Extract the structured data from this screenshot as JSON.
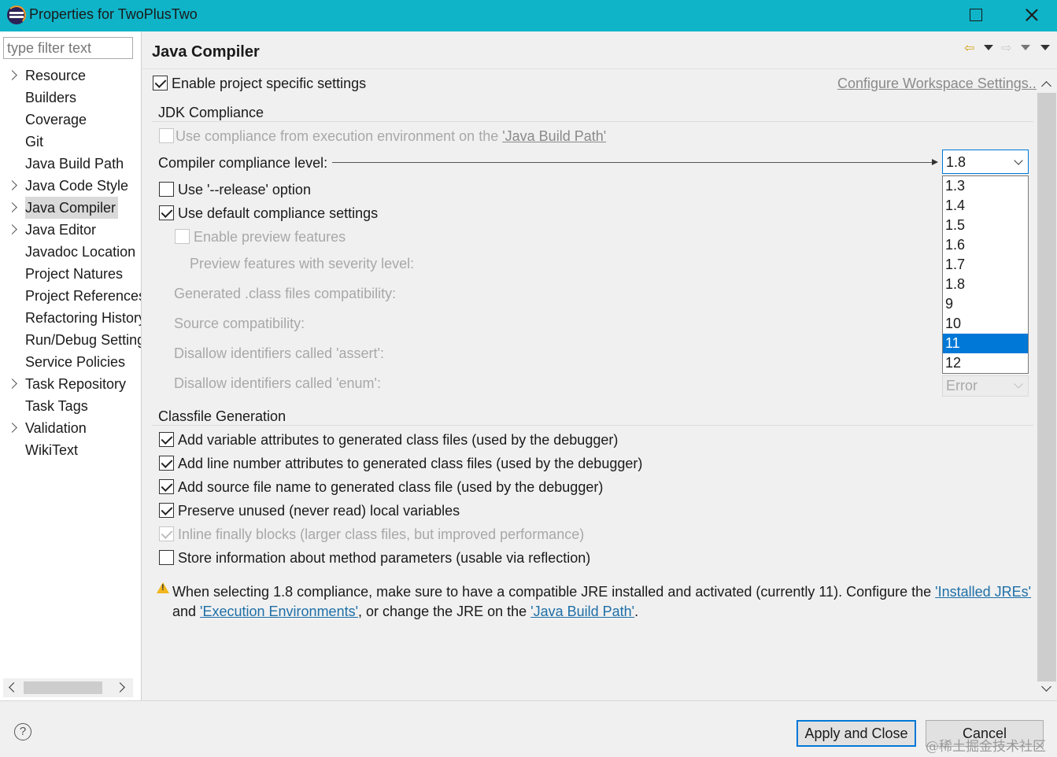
{
  "window": {
    "title": "Properties for TwoPlusTwo"
  },
  "nav": {
    "filter_placeholder": "type filter text",
    "items": [
      {
        "label": "Resource",
        "expandable": true
      },
      {
        "label": "Builders",
        "expandable": false
      },
      {
        "label": "Coverage",
        "expandable": false
      },
      {
        "label": "Git",
        "expandable": false
      },
      {
        "label": "Java Build Path",
        "expandable": false
      },
      {
        "label": "Java Code Style",
        "expandable": true
      },
      {
        "label": "Java Compiler",
        "expandable": true,
        "selected": true
      },
      {
        "label": "Java Editor",
        "expandable": true
      },
      {
        "label": "Javadoc Location",
        "expandable": false
      },
      {
        "label": "Project Natures",
        "expandable": false
      },
      {
        "label": "Project References",
        "expandable": false
      },
      {
        "label": "Refactoring History",
        "expandable": false
      },
      {
        "label": "Run/Debug Settings",
        "expandable": false
      },
      {
        "label": "Service Policies",
        "expandable": false
      },
      {
        "label": "Task Repository",
        "expandable": true
      },
      {
        "label": "Task Tags",
        "expandable": false
      },
      {
        "label": "Validation",
        "expandable": true
      },
      {
        "label": "WikiText",
        "expandable": false
      }
    ]
  },
  "page": {
    "title": "Java Compiler",
    "enable_project_specific": {
      "label": "Enable project specific settings",
      "checked": true
    },
    "configure_workspace_link": "Configure Workspace Settings...",
    "jdk_compliance": {
      "group_label": "JDK Compliance",
      "use_env_compliance": {
        "prefix": "Use compliance from execution environment on the ",
        "link": "'Java Build Path'",
        "checked": false,
        "enabled": false
      },
      "compliance_level_label": "Compiler compliance level:",
      "compliance_level_value": "1.8",
      "compliance_options": [
        "1.3",
        "1.4",
        "1.5",
        "1.6",
        "1.7",
        "1.8",
        "9",
        "10",
        "11",
        "12"
      ],
      "highlighted_option": "11",
      "use_release": {
        "label": "Use '--release' option",
        "checked": false
      },
      "use_default_compliance": {
        "label": "Use default compliance settings",
        "checked": true
      },
      "enable_preview": {
        "label": "Enable preview features",
        "checked": false,
        "enabled": false
      },
      "preview_severity_label": "Preview features with severity level:",
      "generated_class_label": "Generated .class files compatibility:",
      "source_compat_label": "Source compatibility:",
      "disallow_assert_label": "Disallow identifiers called 'assert':",
      "disallow_enum_label": "Disallow identifiers called 'enum':",
      "disallow_enum_value": "Error"
    },
    "classfile_generation": {
      "group_label": "Classfile Generation",
      "options": [
        {
          "label": "Add variable attributes to generated class files (used by the debugger)",
          "checked": true,
          "enabled": true
        },
        {
          "label": "Add line number attributes to generated class files (used by the debugger)",
          "checked": true,
          "enabled": true
        },
        {
          "label": "Add source file name to generated class file (used by the debugger)",
          "checked": true,
          "enabled": true
        },
        {
          "label": "Preserve unused (never read) local variables",
          "checked": true,
          "enabled": true
        },
        {
          "label": "Inline finally blocks (larger class files, but improved performance)",
          "checked": true,
          "enabled": false
        },
        {
          "label": "Store information about method parameters (usable via reflection)",
          "checked": false,
          "enabled": true
        }
      ]
    },
    "warning": {
      "icon": "warning-icon",
      "line1_text": "When selecting 1.8 compliance, make sure to have a compatible JRE installed and activated (currently 11). Configure the ",
      "line1_link": "'Installed JREs'",
      "line2_and": "and ",
      "line2_link1": "'Execution Environments'",
      "line2_mid": ", or change the JRE on the ",
      "line2_link2": "'Java Build Path'",
      "line2_end": "."
    }
  },
  "footer": {
    "apply_close_label": "Apply and Close",
    "cancel_label": "Cancel",
    "help_icon": "help-icon",
    "watermark": "@稀土掘金技术社区"
  },
  "colors": {
    "titlebar": "#0fb4c8",
    "link": "#1d6fa8",
    "selection": "#0078d7",
    "warning": "#f2b61c"
  }
}
